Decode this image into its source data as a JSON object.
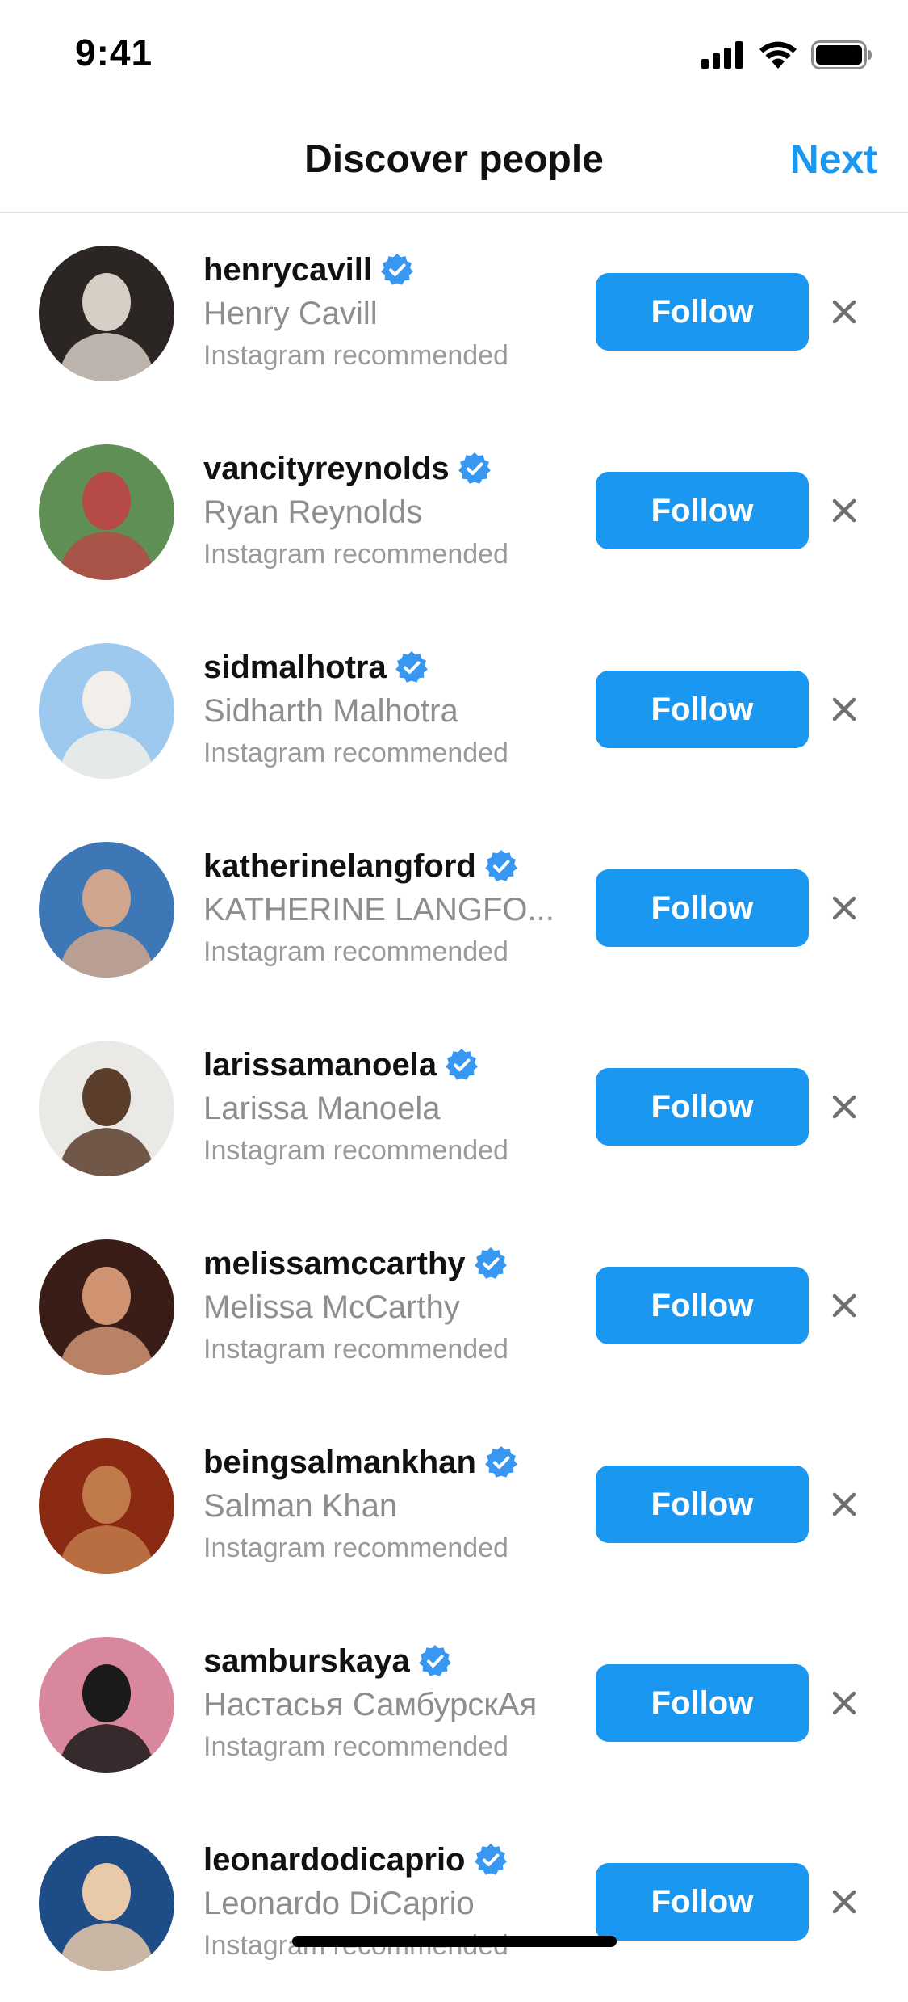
{
  "status_bar": {
    "time": "9:41",
    "icons": [
      "cellular-signal-icon",
      "wifi-icon",
      "battery-icon"
    ]
  },
  "header": {
    "title": "Discover people",
    "next_label": "Next"
  },
  "colors": {
    "accent": "#1a97f0",
    "verified": "#3897f0",
    "secondary_text": "#8e8e8e"
  },
  "suggestions": [
    {
      "username": "henrycavill",
      "full_name": "Henry Cavill",
      "subtitle": "Instagram recommended",
      "verified": true,
      "follow_label": "Follow",
      "avatar_colors": [
        "#2b2623",
        "#d7cfc6"
      ]
    },
    {
      "username": "vancityreynolds",
      "full_name": "Ryan Reynolds",
      "subtitle": "Instagram recommended",
      "verified": true,
      "follow_label": "Follow",
      "avatar_colors": [
        "#5f8f55",
        "#b54a47"
      ]
    },
    {
      "username": "sidmalhotra",
      "full_name": "Sidharth Malhotra",
      "subtitle": "Instagram recommended",
      "verified": true,
      "follow_label": "Follow",
      "avatar_colors": [
        "#9ec9ee",
        "#f2eee9"
      ]
    },
    {
      "username": "katherinelangford",
      "full_name": "KATHERINE LANGFO...",
      "subtitle": "Instagram recommended",
      "verified": true,
      "follow_label": "Follow",
      "avatar_colors": [
        "#3d77b6",
        "#cfa58d"
      ]
    },
    {
      "username": "larissamanoela",
      "full_name": "Larissa Manoela",
      "subtitle": "Instagram recommended",
      "verified": true,
      "follow_label": "Follow",
      "avatar_colors": [
        "#ebe9e6",
        "#5b3d2c"
      ]
    },
    {
      "username": "melissamccarthy",
      "full_name": "Melissa McCarthy",
      "subtitle": "Instagram recommended",
      "verified": true,
      "follow_label": "Follow",
      "avatar_colors": [
        "#3a1d17",
        "#d09472"
      ]
    },
    {
      "username": "beingsalmankhan",
      "full_name": "Salman Khan",
      "subtitle": "Instagram recommended",
      "verified": true,
      "follow_label": "Follow",
      "avatar_colors": [
        "#8a2a12",
        "#c07a4a"
      ]
    },
    {
      "username": "samburskaya",
      "full_name": "Настасья СамбурскАя",
      "subtitle": "Instagram recommended",
      "verified": true,
      "follow_label": "Follow",
      "avatar_colors": [
        "#d9879c",
        "#1a1a1a"
      ]
    },
    {
      "username": "leonardodicaprio",
      "full_name": "Leonardo DiCaprio",
      "subtitle": "Instagram recommended",
      "verified": true,
      "follow_label": "Follow",
      "avatar_colors": [
        "#1d4c87",
        "#e8c9aa"
      ]
    }
  ]
}
